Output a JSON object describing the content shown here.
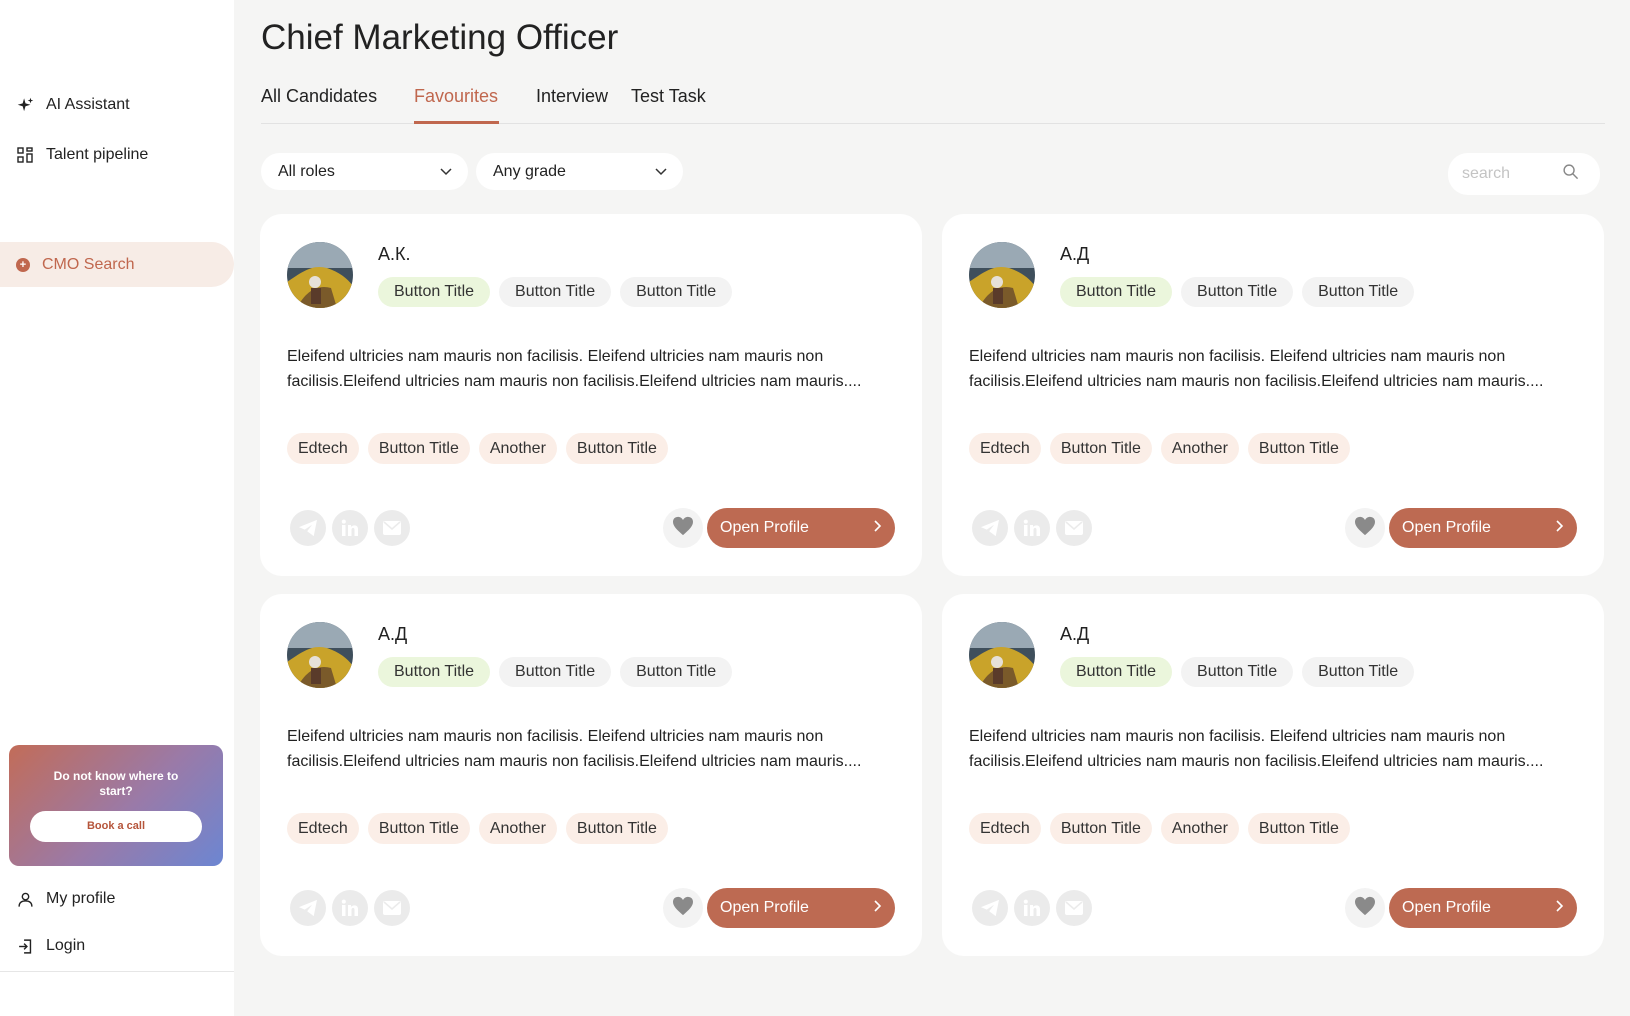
{
  "sidebar": {
    "items": [
      {
        "label": "AI Assistant",
        "icon": "sparkle-icon"
      },
      {
        "label": "Talent pipeline",
        "icon": "grid-icon"
      }
    ],
    "active_search": {
      "label": "CMO Search",
      "icon": "plus-circle-icon"
    },
    "promo": {
      "text": "Do not know where to start?",
      "button": "Book a call"
    },
    "bottom": [
      {
        "label": "My profile",
        "icon": "user-icon"
      },
      {
        "label": "Login",
        "icon": "login-icon"
      }
    ]
  },
  "header": {
    "title": "Chief Marketing Officer",
    "tabs": [
      {
        "label": "All Candidates",
        "active": false
      },
      {
        "label": "Favourites",
        "active": true
      },
      {
        "label": "Interview",
        "active": false
      },
      {
        "label": "Test Task",
        "active": false
      }
    ]
  },
  "filters": {
    "role": "All roles",
    "grade": "Any grade",
    "search_placeholder": "search"
  },
  "candidates": [
    {
      "name": "А.К.",
      "chips": [
        "Button Title",
        "Button Title",
        "Button Title"
      ],
      "description": "Eleifend ultricies nam mauris non facilisis. Eleifend ultricies nam mauris non facilisis.Eleifend ultricies nam mauris non facilisis.Eleifend ultricies nam mauris....",
      "tags": [
        "Edtech",
        "Button Title",
        "Another",
        "Button Title"
      ],
      "open_label": "Open Profile"
    },
    {
      "name": "А.Д",
      "chips": [
        "Button Title",
        "Button Title",
        "Button Title"
      ],
      "description": "Eleifend ultricies nam mauris non facilisis. Eleifend ultricies nam mauris non facilisis.Eleifend ultricies nam mauris non facilisis.Eleifend ultricies nam mauris....",
      "tags": [
        "Edtech",
        "Button Title",
        "Another",
        "Button Title"
      ],
      "open_label": "Open Profile"
    },
    {
      "name": "А.Д",
      "chips": [
        "Button Title",
        "Button Title",
        "Button Title"
      ],
      "description": "Eleifend ultricies nam mauris non facilisis. Eleifend ultricies nam mauris non facilisis.Eleifend ultricies nam mauris non facilisis.Eleifend ultricies nam mauris....",
      "tags": [
        "Edtech",
        "Button Title",
        "Another",
        "Button Title"
      ],
      "open_label": "Open Profile"
    },
    {
      "name": "А.Д",
      "chips": [
        "Button Title",
        "Button Title",
        "Button Title"
      ],
      "description": "Eleifend ultricies nam mauris non facilisis. Eleifend ultricies nam mauris non facilisis.Eleifend ultricies nam mauris non facilisis.Eleifend ultricies nam mauris....",
      "tags": [
        "Edtech",
        "Button Title",
        "Another",
        "Button Title"
      ],
      "open_label": "Open Profile"
    }
  ],
  "colors": {
    "accent": "#c0674e",
    "button": "#bd6a52",
    "chip_highlight": "#ebf6dc",
    "tag_bg": "#fbeee7"
  }
}
